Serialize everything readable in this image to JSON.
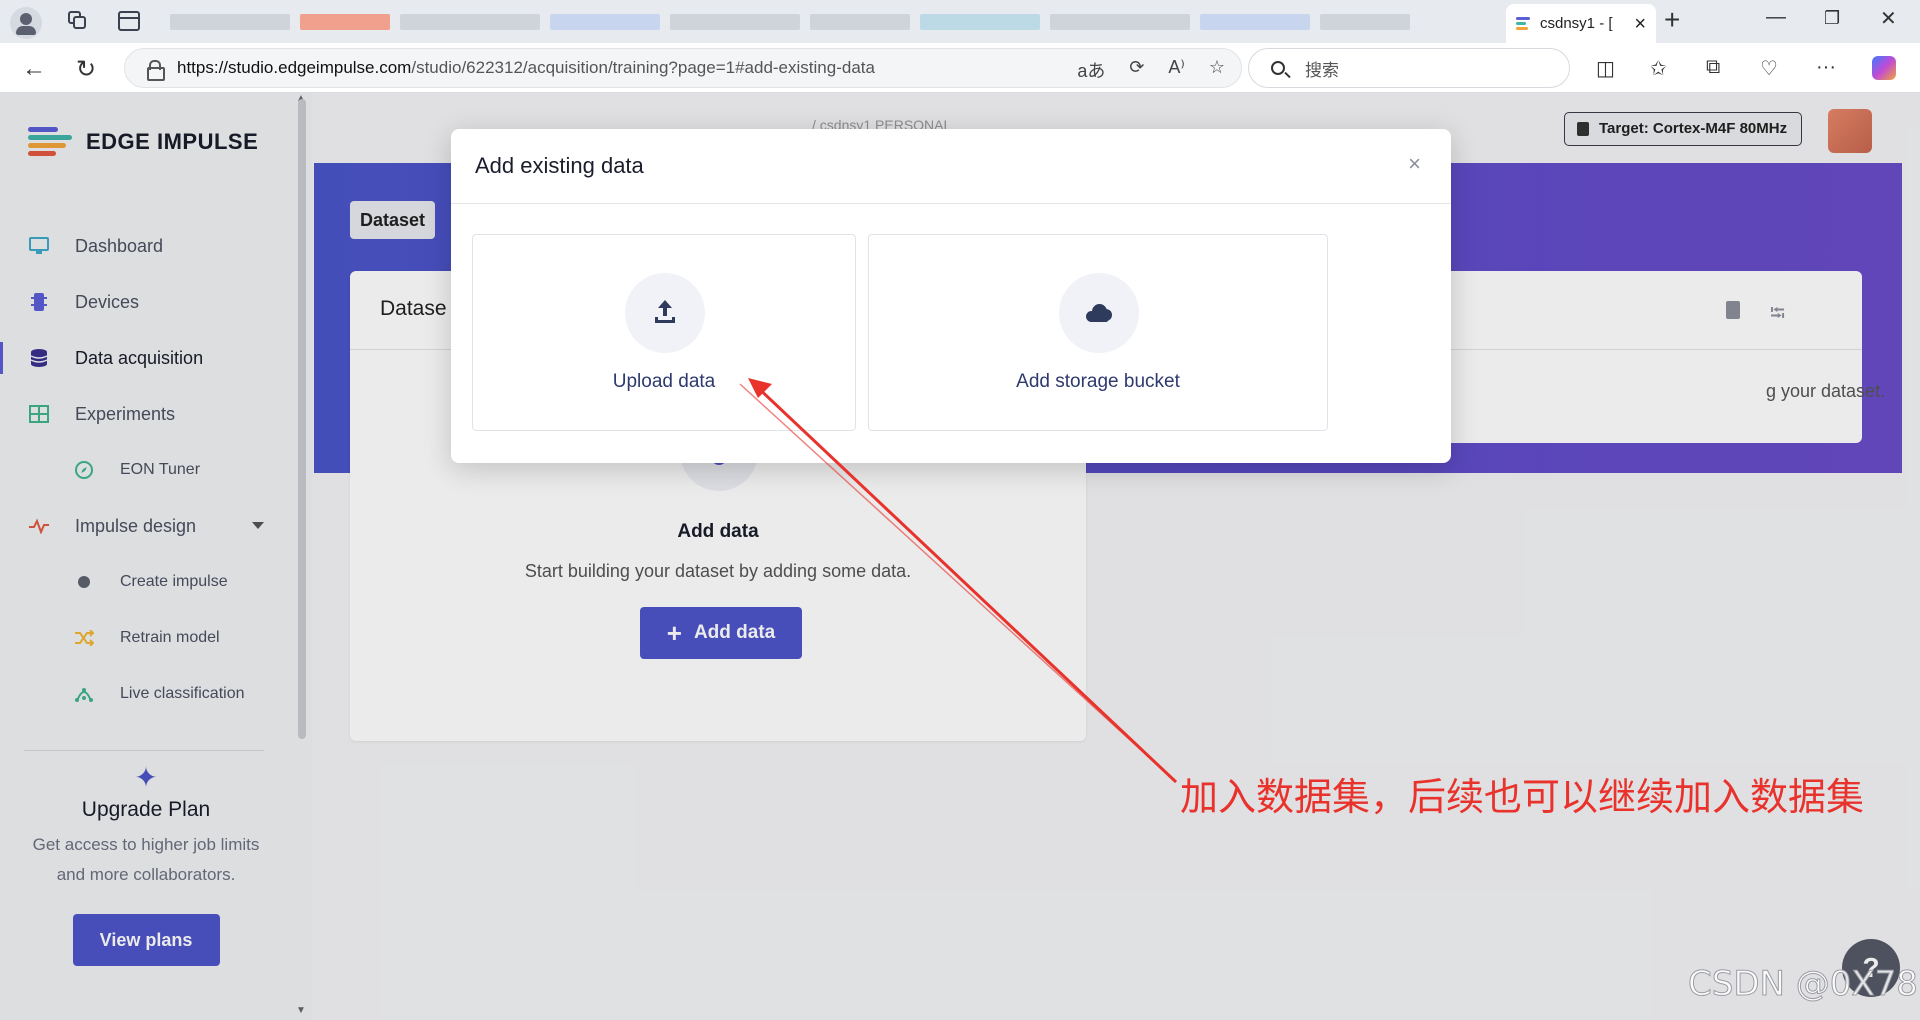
{
  "browser": {
    "active_tab_title": "csdnsy1 - [",
    "url_host": "https://studio.edgeimpulse.com",
    "url_path": "/studio/622312/acquisition/training?page=1#add-existing-data",
    "search_placeholder": "搜索",
    "icons": [
      "profile-icon",
      "collections-icon",
      "vertical-tabs-icon",
      "back-icon",
      "refresh-icon",
      "lock-icon",
      "read-aloud-icon",
      "favorite-icon",
      "split-screen-icon",
      "favorites-icon",
      "collections-icon",
      "health-icon",
      "more-icon",
      "copilot-icon"
    ]
  },
  "app": {
    "brand": "EDGE IMPULSE",
    "brand_colors": [
      "#5b5fd6",
      "#3fb5a6",
      "#f2a43a",
      "#e2593f"
    ],
    "target": "Target: Cortex-M4F 80MHz",
    "breadcrumb": "/ csdnsy1  PERSONAL"
  },
  "sidebar": {
    "items": [
      {
        "label": "Dashboard",
        "icon": "monitor-icon"
      },
      {
        "label": "Devices",
        "icon": "chip-icon"
      },
      {
        "label": "Data acquisition",
        "icon": "database-icon",
        "active": true
      },
      {
        "label": "Experiments",
        "icon": "grid-icon"
      },
      {
        "label": "EON Tuner",
        "icon": "compass-icon"
      },
      {
        "label": "Impulse design",
        "icon": "pulse-icon"
      },
      {
        "label": "Create impulse",
        "icon": "dot-icon"
      },
      {
        "label": "Retrain model",
        "icon": "shuffle-icon"
      },
      {
        "label": "Live classification",
        "icon": "network-icon"
      }
    ],
    "upgrade": {
      "title": "Upgrade Plan",
      "description": "Get access to higher job limits and more collaborators.",
      "button": "View plans"
    }
  },
  "main": {
    "dataset_tab": "Dataset",
    "card_title": "Datase",
    "empty_title": "Add data",
    "empty_subtitle": "Start building your dataset by adding some data.",
    "add_data_button": "Add data",
    "right_card_text": "g your dataset.",
    "help": "?"
  },
  "modal": {
    "title": "Add existing data",
    "close": "×",
    "options": [
      {
        "label": "Upload data",
        "icon": "upload-icon"
      },
      {
        "label": "Add storage bucket",
        "icon": "cloud-icon"
      }
    ]
  },
  "annotation": {
    "text": "加入数据集，后续也可以继续加入数据集",
    "color": "#e8322b"
  },
  "watermark": "CSDN @0X78"
}
